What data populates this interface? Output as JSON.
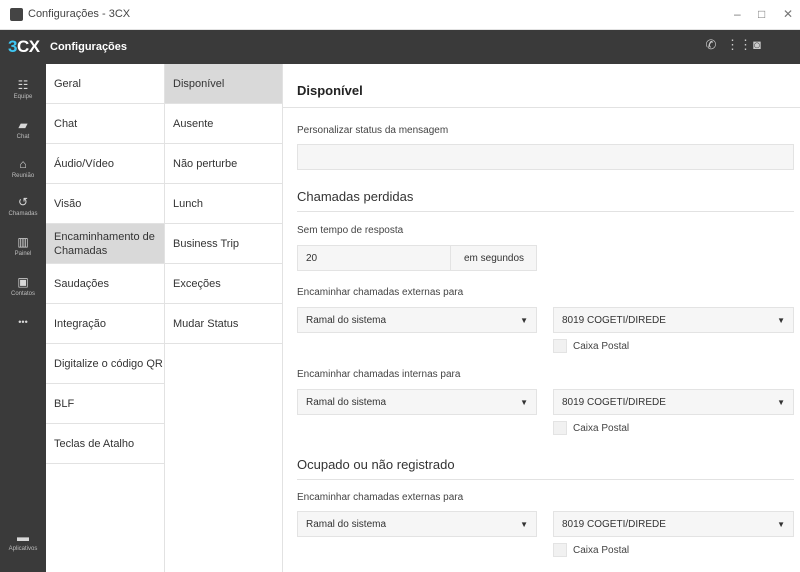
{
  "window": {
    "title": "Configurações - 3CX",
    "controls": [
      "–",
      "□",
      "✕"
    ]
  },
  "header": {
    "logo_digit": "3",
    "logo_text": "CX",
    "title": "Configurações"
  },
  "sidebar": {
    "items": [
      {
        "icon": "team-icon",
        "glyph": "☷",
        "label": "Equipe"
      },
      {
        "icon": "chat-icon",
        "glyph": "▰",
        "label": "Chat"
      },
      {
        "icon": "meeting-icon",
        "glyph": "⌂",
        "label": "Reunião"
      },
      {
        "icon": "calls-icon",
        "glyph": "↺",
        "label": "Chamadas"
      },
      {
        "icon": "panel-icon",
        "glyph": "▥",
        "label": "Painel"
      },
      {
        "icon": "contacts-icon",
        "glyph": "▣",
        "label": "Contatos"
      },
      {
        "icon": "more-icon",
        "glyph": "•••",
        "label": ""
      }
    ],
    "bottom": {
      "glyph": "▬",
      "label": "Aplicativos"
    }
  },
  "menu1": {
    "items": [
      "Geral",
      "Chat",
      "Áudio/Vídeo",
      "Visão",
      "Encaminhamento de Chamadas",
      "Saudações",
      "Integração",
      "Digitalize o código QR",
      "BLF",
      "Teclas de Atalho"
    ],
    "active": 4
  },
  "menu2": {
    "items": [
      "Disponível",
      "Ausente",
      "Não perturbe",
      "Lunch",
      "Business Trip",
      "Exceções",
      "Mudar Status"
    ],
    "active": 0
  },
  "main": {
    "title": "Disponível",
    "custom_status_label": "Personalizar status da mensagem",
    "custom_status_value": "",
    "missed": {
      "heading": "Chamadas perdidas",
      "no_answer_label": "Sem tempo de resposta",
      "no_answer_value": "20",
      "no_answer_unit": "em segundos",
      "external_label": "Encaminhar chamadas externas para",
      "external_select": "Ramal do sistema",
      "external_target": "8019 COGETI/DIREDE",
      "external_voicemail": "Caixa Postal",
      "internal_label": "Encaminhar chamadas internas para",
      "internal_select": "Ramal do sistema",
      "internal_target": "8019 COGETI/DIREDE",
      "internal_voicemail": "Caixa Postal"
    },
    "busy": {
      "heading": "Ocupado ou não registrado",
      "external_label": "Encaminhar chamadas externas para",
      "external_select": "Ramal do sistema",
      "external_target": "8019 COGETI/DIREDE",
      "external_voicemail": "Caixa Postal"
    }
  }
}
